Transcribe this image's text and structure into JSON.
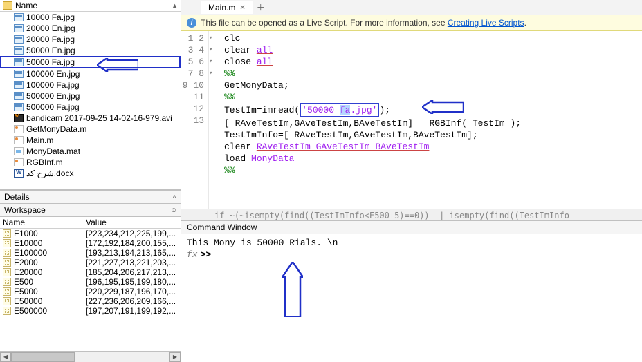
{
  "file_browser": {
    "header": "Name",
    "items": [
      {
        "name": "10000 Fa.jpg",
        "icon": "img"
      },
      {
        "name": "20000 En.jpg",
        "icon": "img"
      },
      {
        "name": "20000 Fa.jpg",
        "icon": "img"
      },
      {
        "name": "50000 En.jpg",
        "icon": "img"
      },
      {
        "name": "50000 Fa.jpg",
        "icon": "img",
        "selected": true
      },
      {
        "name": "100000 En.jpg",
        "icon": "img"
      },
      {
        "name": "100000 Fa.jpg",
        "icon": "img"
      },
      {
        "name": "500000 En.jpg",
        "icon": "img"
      },
      {
        "name": "500000 Fa.jpg",
        "icon": "img"
      },
      {
        "name": "bandicam 2017-09-25 14-02-16-979.avi",
        "icon": "avi"
      },
      {
        "name": "GetMonyData.m",
        "icon": "m"
      },
      {
        "name": "Main.m",
        "icon": "m"
      },
      {
        "name": "MonyData.mat",
        "icon": "mat"
      },
      {
        "name": "RGBInf.m",
        "icon": "m"
      },
      {
        "name": "شرح کد.docx",
        "icon": "doc"
      }
    ]
  },
  "details": {
    "title": "Details"
  },
  "workspace": {
    "title": "Workspace",
    "cols": {
      "name": "Name",
      "value": "Value"
    },
    "vars": [
      {
        "name": "E1000",
        "value": "[223,234,212,225,199,..."
      },
      {
        "name": "E10000",
        "value": "[172,192,184,200,155,..."
      },
      {
        "name": "E100000",
        "value": "[193,213,194,213,165,..."
      },
      {
        "name": "E2000",
        "value": "[221,227,213,221,203,..."
      },
      {
        "name": "E20000",
        "value": "[185,204,206,217,213,..."
      },
      {
        "name": "E500",
        "value": "[196,195,195,199,180,..."
      },
      {
        "name": "E5000",
        "value": "[220,229,187,196,170,..."
      },
      {
        "name": "E50000",
        "value": "[227,236,206,209,166,..."
      },
      {
        "name": "E500000",
        "value": "[197,207,191,199,192,..."
      }
    ]
  },
  "editor": {
    "tab": "Main.m",
    "info_prefix": "This file can be opened as a Live Script. For more information, see ",
    "info_link": "Creating Live Scripts",
    "info_suffix": ".",
    "code": {
      "l1": "clc",
      "l2_a": "clear ",
      "l2_b": "all",
      "l3_a": "close ",
      "l3_b": "all",
      "l4": "%%",
      "l5": "GetMonyData;",
      "l6": "%%",
      "l7_a": "TestIm=imread(",
      "l7_b1": "'50000 ",
      "l7_b2": "fa",
      "l7_b3": ".jpg'",
      "l7_c": ");",
      "l8_a": "[ RAveTestIm,GAveTestIm,BAveTestIm] = RGBInf( TestIm );",
      "l9_a": "TestImInfo=[ RAveTestIm,GAveTestIm,BAveTestIm];",
      "l10_a": "clear ",
      "l10_b": "RAveTestIm GAveTestIm BAveTestIm",
      "l11_a": "load ",
      "l11_b": "MonyData",
      "l12": "%%",
      "l13": "",
      "partial": "    if    ~(~isempty(find((TestImInfo<E500+5)==0)) || isempty(find((TestImInfo"
    }
  },
  "command": {
    "title": "Command Window",
    "output": "  This Mony is 50000 Rials. \\n",
    "prompt": ">>"
  }
}
